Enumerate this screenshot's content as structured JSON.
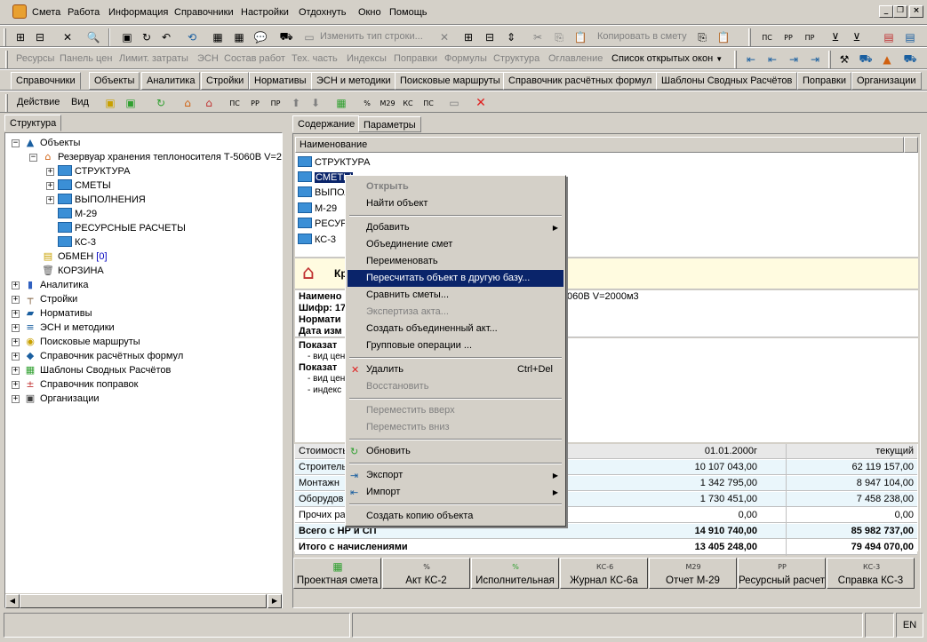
{
  "menu": [
    "Смета",
    "Работа",
    "Информация",
    "Справочники",
    "Настройки",
    "Отдохнуть",
    "Окно",
    "Помощь"
  ],
  "toolbar1": {
    "change_type": "Изменить тип строки...",
    "copy_to_estimate": "Копировать в смету"
  },
  "toolbar2": {
    "links": [
      "Ресурсы",
      "Панель цен",
      "Лимит. затраты",
      "ЭСН",
      "Состав работ",
      "Тех. часть",
      "Индексы",
      "Поправки",
      "Формулы",
      "Структура",
      "Оглавление"
    ],
    "open_windows": "Список открытых окон"
  },
  "tabs": [
    "Справочники",
    "Объекты",
    "Аналитика",
    "Стройки",
    "Нормативы",
    "ЭСН и методики",
    "Поисковые маршруты",
    "Справочник расчётных формул",
    "Шаблоны Сводных Расчётов",
    "Поправки",
    "Организации"
  ],
  "toolbar3": {
    "action": "Действие",
    "view": "Вид"
  },
  "left_tab": "Структура",
  "tree": {
    "root": "Объекты",
    "object": "Резервуар хранения теплоносителя Т-5060В V=2",
    "children": [
      "СТРУКТУРА",
      "СМЕТЫ",
      "ВЫПОЛНЕНИЯ",
      "М-29",
      "РЕСУРСНЫЕ РАСЧЕТЫ",
      "КС-3"
    ],
    "exchange": "ОБМЕН",
    "exchange_count": "[0]",
    "basket": "КОРЗИНА",
    "top": [
      "Аналитика",
      "Стройки",
      "Нормативы",
      "ЭСН и методики",
      "Поисковые маршруты",
      "Справочник расчётных формул",
      "Шаблоны Сводных Расчётов",
      "Справочник поправок",
      "Организации"
    ]
  },
  "right_tabs": [
    "Содержание",
    "Параметры"
  ],
  "content": {
    "column": "Наименование",
    "items": [
      "СТРУКТУРА",
      "СМЕТЫ",
      "ВЫПОЛ",
      "М-29",
      "РЕСУР",
      "КС-3"
    ],
    "header_partial": "Кр",
    "info_labels": [
      "Наимено",
      "Шифр: 17",
      "Нормати",
      "Дата изм"
    ],
    "info_right": "060В V=2000м3",
    "indicators": [
      "Показат",
      "- вид цен",
      "Показат",
      "- вид цен",
      "- индекс"
    ]
  },
  "costs": {
    "headers": [
      "Стоимость",
      "01.01.2000г",
      "текущий"
    ],
    "rows": [
      {
        "name": "Строитель",
        "base": "10 107 043,00",
        "cur": "62 119 157,00"
      },
      {
        "name": "Монтажн",
        "base": "1 342 795,00",
        "cur": "8 947 104,00"
      },
      {
        "name": "Оборудов",
        "base": "1 730 451,00",
        "cur": "7 458 238,00"
      },
      {
        "name": "Прочих ра",
        "base": "0,00",
        "cur": "0,00"
      }
    ],
    "total1": {
      "name": "Всего с НР и СП",
      "base": "14 910 740,00",
      "cur": "85 982 737,00"
    },
    "total2": {
      "name": "Итого с начислениями",
      "base": "13 405 248,00",
      "cur": "79 494 070,00"
    }
  },
  "context_menu": {
    "open": "Открыть",
    "find": "Найти объект",
    "add": "Добавить",
    "merge": "Объединение смет",
    "rename": "Переименовать",
    "recalc": "Пересчитать объект в другую базу...",
    "compare": "Сравнить сметы...",
    "expertise": "Экспертиза акта...",
    "create_act": "Создать объединенный акт...",
    "group_ops": "Групповые операции ...",
    "delete": "Удалить",
    "delete_sc": "Ctrl+Del",
    "restore": "Восстановить",
    "move_up": "Переместить вверх",
    "move_down": "Переместить вниз",
    "refresh": "Обновить",
    "export": "Экспорт",
    "import": "Импорт",
    "copy": "Создать копию объекта"
  },
  "bottom_buttons": [
    {
      "icon": "▦",
      "label": "Проектная смета"
    },
    {
      "icon": "%",
      "label": "Акт КС-2"
    },
    {
      "icon": "%",
      "label": "Исполнительная"
    },
    {
      "icon": "КС-6",
      "label": "Журнал КС-6а"
    },
    {
      "icon": "М29",
      "label": "Отчет М-29"
    },
    {
      "icon": "РР",
      "label": "Ресурсный расчет"
    },
    {
      "icon": "КС-3",
      "label": "Справка КС-3"
    }
  ],
  "status": {
    "lang": "EN"
  }
}
